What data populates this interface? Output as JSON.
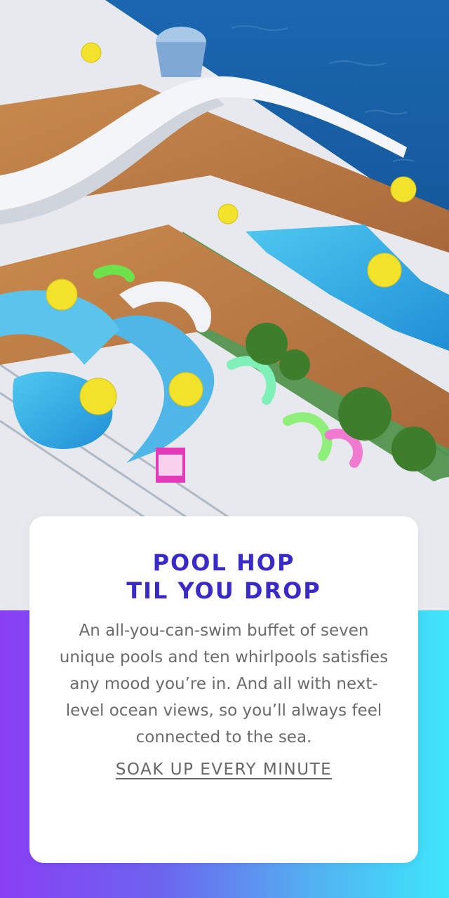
{
  "hero": {
    "image_icon": "cruise-ship-pool-deck-image"
  },
  "card": {
    "headline_line1": "POOL HOP",
    "headline_line2": "TIL YOU DROP",
    "body": "An all-you-can-swim buffet of seven unique pools and ten whirlpools satisfies any mood you’re in. And all with next-level ocean views, so you’ll always feel connected to the sea.",
    "cta_label": "SOAK UP EVERY MINUTE"
  },
  "colors": {
    "headline": "#3a2bc6",
    "body_text": "#6b6b6b",
    "band_left": "#8a3ff5",
    "band_right": "#3de6fb",
    "ocean": "#1b5fa3"
  }
}
